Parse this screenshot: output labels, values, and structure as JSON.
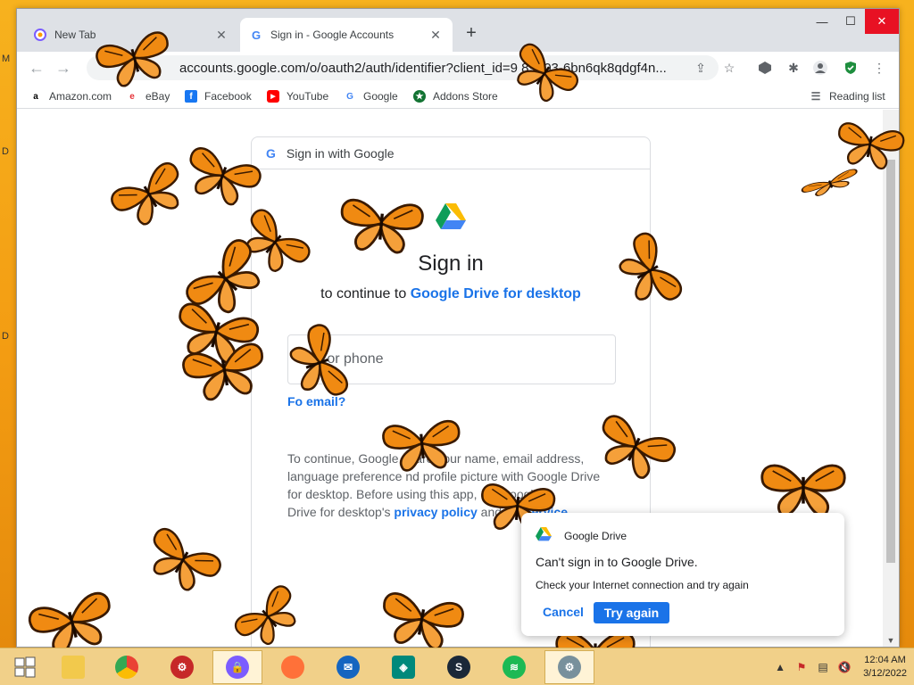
{
  "desktop": {
    "letters": [
      "M",
      "D",
      "D"
    ]
  },
  "tabs": [
    {
      "label": "New Tab",
      "icon": "brave-icon"
    },
    {
      "label": "Sign in - Google Accounts",
      "icon": "google-icon"
    }
  ],
  "window_controls": {
    "minimize": "—",
    "maximize": "☐",
    "close": "✕"
  },
  "address_bar": {
    "url": "accounts.google.com/o/oauth2/auth/identifier?client_id=9   89803-6bn6qk8qdgf4n..."
  },
  "bookmarks": [
    {
      "label": "Amazon.com",
      "icon": "amazon-icon"
    },
    {
      "label": "eBay",
      "icon": "ebay-icon"
    },
    {
      "label": "Facebook",
      "icon": "facebook-icon"
    },
    {
      "label": "YouTube",
      "icon": "youtube-icon"
    },
    {
      "label": "Google",
      "icon": "google-icon"
    },
    {
      "label": "Addons Store",
      "icon": "addons-icon"
    }
  ],
  "reading_list": "Reading list",
  "signin": {
    "header": "Sign in with Google",
    "title": "Sign in",
    "subtitle_prefix": "to continue to ",
    "subtitle_link": "Google Drive for desktop",
    "email_placeholder": "nail or phone",
    "forgot": "Fo      email?",
    "consent_lines": [
      "To continue, Google    share your name, email address,",
      "language preference    nd profile picture with Google Drive",
      "for desktop. Before using this app,        ew Google",
      "Drive for desktop's "
    ],
    "privacy_link": "privacy policy",
    "and_text": " and ",
    "terms_link": "ter         service"
  },
  "toast": {
    "app": "Google Drive",
    "title": "Can't sign in to Google Drive.",
    "body": "Check your Internet connection and try again",
    "cancel": "Cancel",
    "try_again": "Try again"
  },
  "clock": {
    "time": "12:04 AM",
    "date": "3/12/2022"
  },
  "colors": {
    "accent": "#1a73e8",
    "desktop": "#f5a623",
    "butterfly": "#f08a12"
  }
}
